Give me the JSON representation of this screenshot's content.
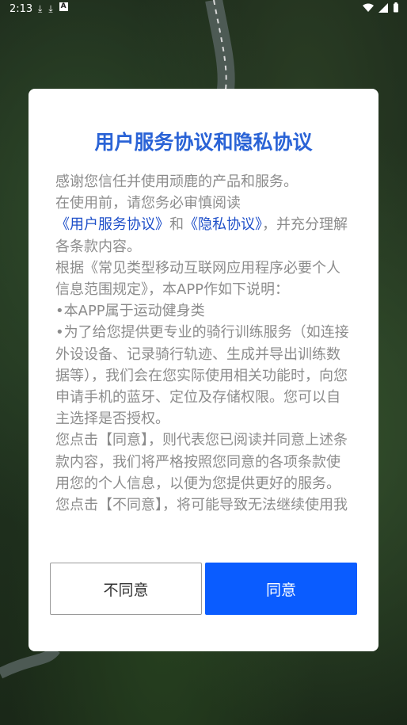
{
  "status_bar": {
    "time": "2:13",
    "left_icons": [
      "download-icon",
      "download-icon",
      "keyboard-a-icon"
    ],
    "right_icons": [
      "wifi-icon",
      "signal-icon",
      "battery-icon"
    ]
  },
  "dialog": {
    "title": "用户服务协议和隐私协议",
    "paragraphs": {
      "p1": "感谢您信任并使用顽鹿的产品和服务。",
      "p2_prefix": "在使用前，请您务必审慎阅读",
      "p2_link1": "《用户服务协议》",
      "p2_mid": "和",
      "p2_link2": "《隐私协议》",
      "p2_suffix": "，并充分理解各条款内容。",
      "p3": "根据《常见类型移动互联网应用程序必要个人信息范围规定》，本APP作如下说明：",
      "bullet1": "本APP属于运动健身类",
      "bullet2": "为了给您提供更专业的骑行训练服务（如连接外设设备、记录骑行轨迹、生成并导出训练数据等），我们会在您实际使用相关功能时，向您申请手机的蓝牙、定位及存储权限。您可以自主选择是否授权。",
      "p4": "您点击【同意】，则代表您已阅读并同意上述条款内容，我们将严格按照您同意的各项条款使用您的个人信息，以便为您提供更好的服务。您点击【不同意】，将可能导致无法继续使用我们的产品和服务。"
    },
    "bullet_char": "•",
    "buttons": {
      "disagree": "不同意",
      "agree": "同意"
    }
  },
  "colors": {
    "title": "#2a63d6",
    "link": "#1e4fc9",
    "agree_bg": "#0a5cff",
    "body_text": "#8c8c8c"
  }
}
